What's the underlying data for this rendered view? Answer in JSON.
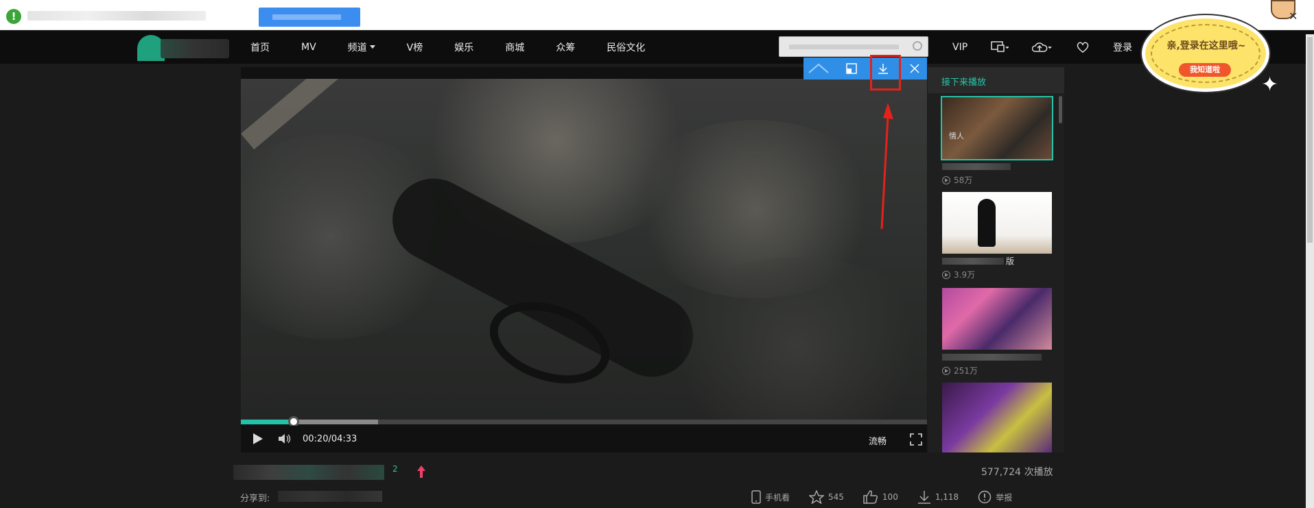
{
  "nav": {
    "items": [
      {
        "label": "首页"
      },
      {
        "label": "MV"
      },
      {
        "label": "频道"
      },
      {
        "label": "V榜"
      },
      {
        "label": "娱乐"
      },
      {
        "label": "商城"
      },
      {
        "label": "众筹"
      },
      {
        "label": "民俗文化"
      }
    ],
    "vip": "VIP",
    "login": "登录"
  },
  "popup": {
    "message": "亲,登录在这里哦~",
    "button": "我知道啦"
  },
  "player": {
    "time": "00:20/04:33",
    "quality": "流畅",
    "progress_fraction": 0.077,
    "buffered_fraction": 0.2
  },
  "sidebar": {
    "title": "接下来播放",
    "items": [
      {
        "count": "58万",
        "caption": "情人"
      },
      {
        "count": "3.9万",
        "caption_suffix": "版"
      },
      {
        "count": "251万"
      },
      {
        "count": ""
      }
    ]
  },
  "below": {
    "badge": "2",
    "plays_number": "577,724",
    "plays_unit": "次播放",
    "share_label": "分享到:",
    "actions": {
      "mobile": "手机看",
      "favorite": "545",
      "like": "100",
      "download": "1,118",
      "report": "举报"
    }
  },
  "colors": {
    "accent": "#25c6a8",
    "highlight": "#e2231a",
    "toolbar": "#2f8fe6"
  }
}
